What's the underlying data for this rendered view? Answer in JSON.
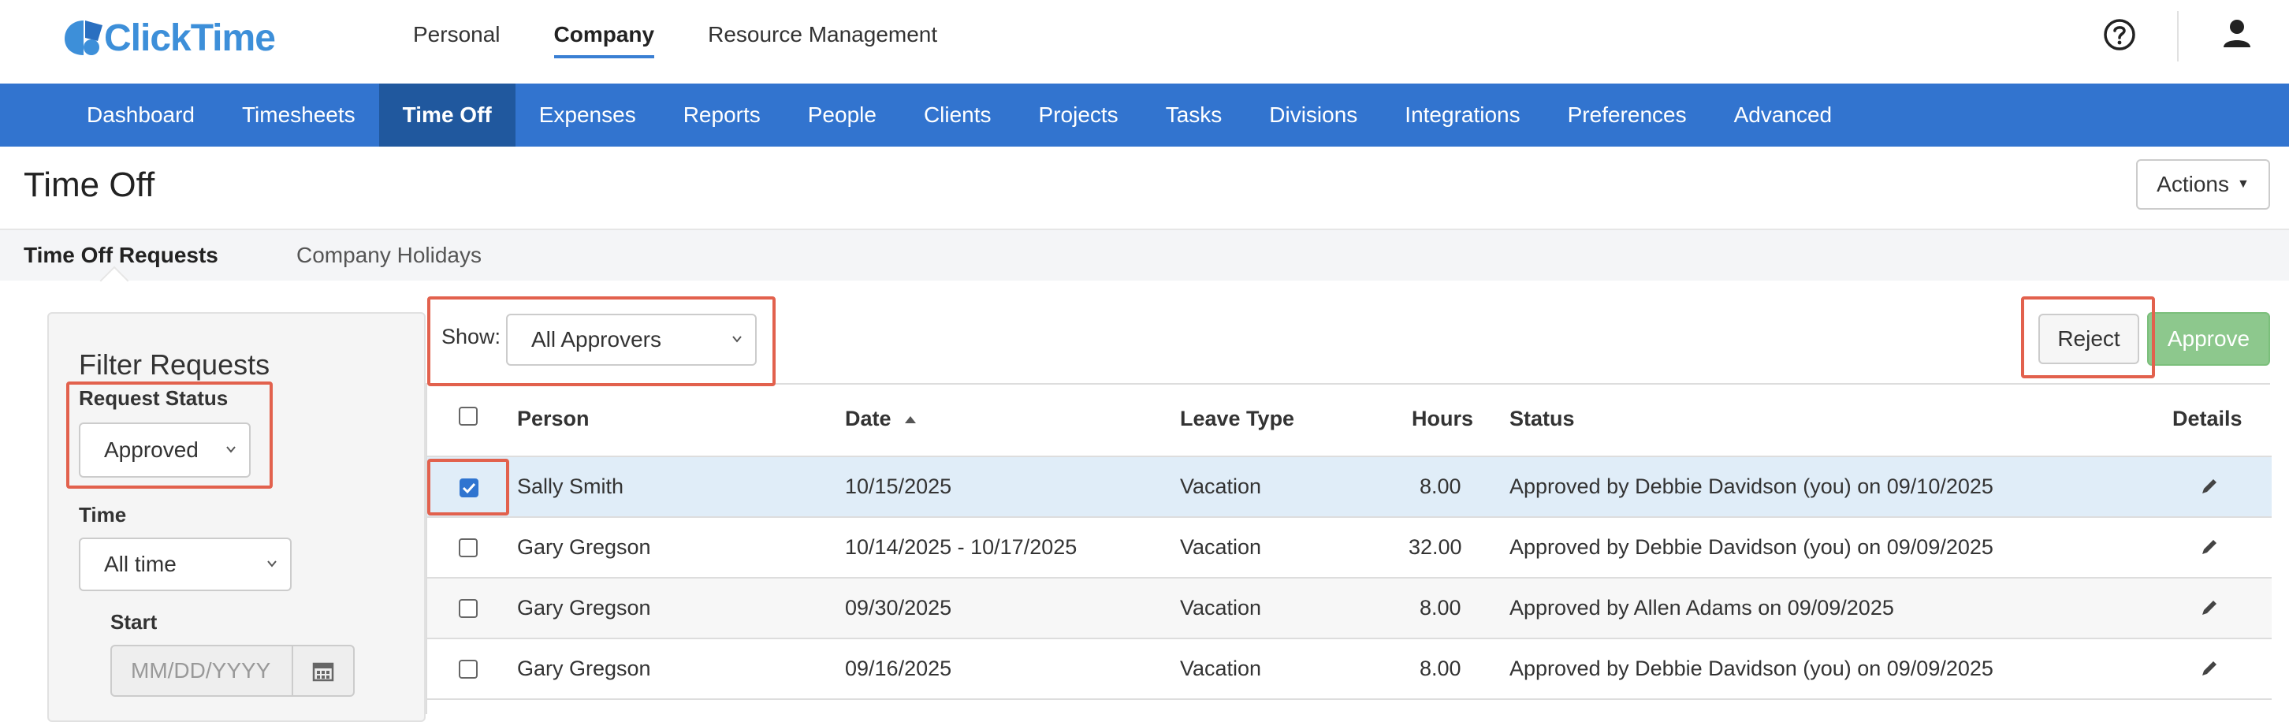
{
  "header": {
    "logo_text": "ClickTime",
    "top_nav": [
      {
        "label": "Personal",
        "active": false
      },
      {
        "label": "Company",
        "active": true
      },
      {
        "label": "Resource Management",
        "active": false
      }
    ]
  },
  "main_nav": [
    {
      "label": "Dashboard",
      "active": false
    },
    {
      "label": "Timesheets",
      "active": false
    },
    {
      "label": "Time Off",
      "active": true
    },
    {
      "label": "Expenses",
      "active": false
    },
    {
      "label": "Reports",
      "active": false
    },
    {
      "label": "People",
      "active": false
    },
    {
      "label": "Clients",
      "active": false
    },
    {
      "label": "Projects",
      "active": false
    },
    {
      "label": "Tasks",
      "active": false
    },
    {
      "label": "Divisions",
      "active": false
    },
    {
      "label": "Integrations",
      "active": false
    },
    {
      "label": "Preferences",
      "active": false
    },
    {
      "label": "Advanced",
      "active": false
    }
  ],
  "page": {
    "title": "Time Off",
    "actions_label": "Actions"
  },
  "subtabs": {
    "active": "Time Off Requests",
    "other": "Company Holidays"
  },
  "filter": {
    "title": "Filter Requests",
    "status_label": "Request Status",
    "status_value": "Approved",
    "time_label": "Time",
    "time_value": "All time",
    "start_label": "Start",
    "start_placeholder": "MM/DD/YYYY"
  },
  "toolbar": {
    "show_label": "Show:",
    "show_value": "All Approvers",
    "reject_label": "Reject",
    "approve_label": "Approve"
  },
  "table": {
    "headers": {
      "person": "Person",
      "date": "Date",
      "leave_type": "Leave Type",
      "hours": "Hours",
      "status": "Status",
      "details": "Details"
    },
    "rows": [
      {
        "person": "Sally Smith",
        "date": "10/15/2025",
        "leave_type": "Vacation",
        "hours": "8.00",
        "status": "Approved by Debbie Davidson (you) on 09/10/2025",
        "checked": true
      },
      {
        "person": "Gary Gregson",
        "date": "10/14/2025 - 10/17/2025",
        "leave_type": "Vacation",
        "hours": "32.00",
        "status": "Approved by Debbie Davidson (you) on 09/09/2025",
        "checked": false
      },
      {
        "person": "Gary Gregson",
        "date": "09/30/2025",
        "leave_type": "Vacation",
        "hours": "8.00",
        "status": "Approved by Allen Adams on 09/09/2025",
        "checked": false
      },
      {
        "person": "Gary Gregson",
        "date": "09/16/2025",
        "leave_type": "Vacation",
        "hours": "8.00",
        "status": "Approved by Debbie Davidson (you) on 09/09/2025",
        "checked": false
      }
    ]
  },
  "colors": {
    "brand_blue": "#3274cf",
    "active_nav": "#20589e",
    "approve_green": "#8dc88d",
    "highlight_red": "#e2614d",
    "selected_row": "#e0edf8"
  }
}
